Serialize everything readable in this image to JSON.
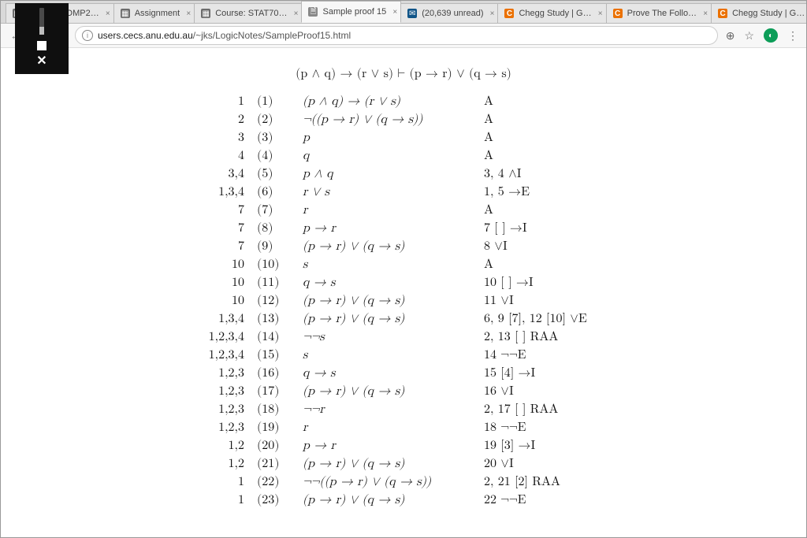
{
  "window_controls": {
    "minimize": "—",
    "maximize": "▭",
    "close": "✕"
  },
  "tabs": [
    {
      "title": "Course: COMP2…",
      "favClass": "",
      "active": false
    },
    {
      "title": "Assignment",
      "favClass": "",
      "active": false
    },
    {
      "title": "Course: STAT70…",
      "favClass": "",
      "active": false
    },
    {
      "title": "Sample proof 15",
      "favClass": "doc",
      "active": true
    },
    {
      "title": "(20,639 unread)",
      "favClass": "mail",
      "active": false
    },
    {
      "title": "Chegg Study | G…",
      "favClass": "chegg",
      "active": false
    },
    {
      "title": "Prove The Follo…",
      "favClass": "chegg",
      "active": false
    },
    {
      "title": "Chegg Study | G…",
      "favClass": "chegg",
      "active": false
    }
  ],
  "toolbar": {
    "back": "←",
    "forward": "→",
    "reload": "↻",
    "url_host": "users.cecs.anu.edu.au",
    "url_path": "/~jks/LogicNotes/SampleProof15.html",
    "zoom": "⊕",
    "star": "☆",
    "menu": "⋮",
    "ext": "◐"
  },
  "overlay": {
    "close": "✕"
  },
  "proof": {
    "header": "(p ∧ q) → (r ∨ s)   ⊢   (p → r) ∨ (q → s)",
    "rows": [
      {
        "deps": "1",
        "num": "(1)",
        "formula": "(p ∧ q) → (r ∨ s)",
        "just": "A"
      },
      {
        "deps": "2",
        "num": "(2)",
        "formula": "¬((p → r) ∨ (q → s))",
        "just": "A"
      },
      {
        "deps": "3",
        "num": "(3)",
        "formula": "p",
        "just": "A"
      },
      {
        "deps": "4",
        "num": "(4)",
        "formula": "q",
        "just": "A"
      },
      {
        "deps": "3,4",
        "num": "(5)",
        "formula": "p ∧ q",
        "just": "3, 4  ∧I"
      },
      {
        "deps": "1,3,4",
        "num": "(6)",
        "formula": "r ∨ s",
        "just": "1, 5  →E"
      },
      {
        "deps": "7",
        "num": "(7)",
        "formula": "r",
        "just": "A"
      },
      {
        "deps": "7",
        "num": "(8)",
        "formula": "p → r",
        "just": "7 [ ]  →I"
      },
      {
        "deps": "7",
        "num": "(9)",
        "formula": "(p → r) ∨ (q → s)",
        "just": "8  ∨I"
      },
      {
        "deps": "10",
        "num": "(10)",
        "formula": "s",
        "just": "A"
      },
      {
        "deps": "10",
        "num": "(11)",
        "formula": "q → s",
        "just": "10 [ ]  →I"
      },
      {
        "deps": "10",
        "num": "(12)",
        "formula": "(p → r) ∨ (q → s)",
        "just": "11  ∨I"
      },
      {
        "deps": "1,3,4",
        "num": "(13)",
        "formula": "(p → r) ∨ (q → s)",
        "just": "6, 9 [7], 12 [10]  ∨E"
      },
      {
        "deps": "1,2,3,4",
        "num": "(14)",
        "formula": "¬¬s",
        "just": "2, 13 [ ]  RAA"
      },
      {
        "deps": "1,2,3,4",
        "num": "(15)",
        "formula": "s",
        "just": "14  ¬¬E"
      },
      {
        "deps": "1,2,3",
        "num": "(16)",
        "formula": "q → s",
        "just": "15 [4]  →I"
      },
      {
        "deps": "1,2,3",
        "num": "(17)",
        "formula": "(p → r) ∨ (q → s)",
        "just": "16  ∨I"
      },
      {
        "deps": "1,2,3",
        "num": "(18)",
        "formula": "¬¬r",
        "just": "2, 17 [ ]  RAA"
      },
      {
        "deps": "1,2,3",
        "num": "(19)",
        "formula": "r",
        "just": "18  ¬¬E"
      },
      {
        "deps": "1,2",
        "num": "(20)",
        "formula": "p → r",
        "just": "19 [3]  →I"
      },
      {
        "deps": "1,2",
        "num": "(21)",
        "formula": "(p → r) ∨ (q → s)",
        "just": "20  ∨I"
      },
      {
        "deps": "1",
        "num": "(22)",
        "formula": "¬¬((p → r) ∨ (q → s))",
        "just": "2, 21 [2]  RAA"
      },
      {
        "deps": "1",
        "num": "(23)",
        "formula": "(p → r) ∨ (q → s)",
        "just": "22  ¬¬E"
      }
    ]
  }
}
